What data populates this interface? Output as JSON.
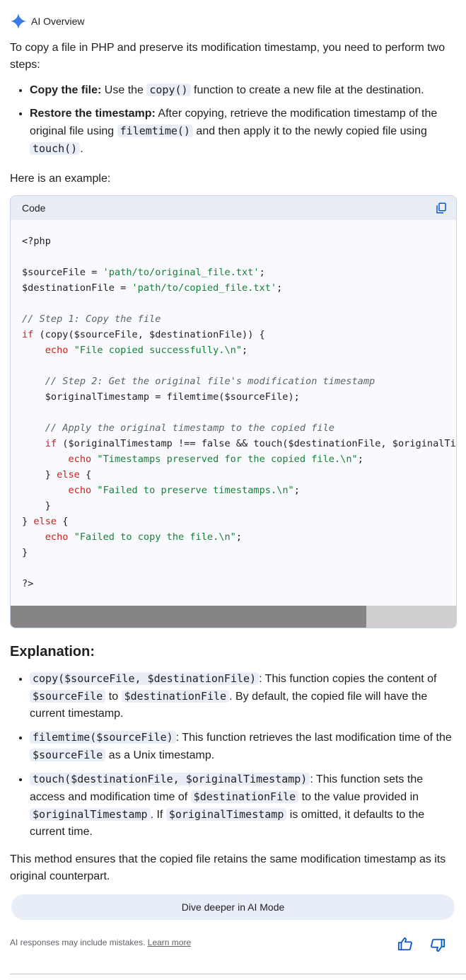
{
  "header": {
    "title": "AI Overview",
    "icon": "sparkle-icon"
  },
  "intro": "To copy a file in PHP and preserve its modification timestamp, you need to perform two steps:",
  "steps": [
    {
      "bold": "Copy the file:",
      "pre": " Use the ",
      "code": "copy()",
      "post": " function to create a new file at the destination."
    },
    {
      "bold": "Restore the timestamp:",
      "pre": " After copying, retrieve the modification timestamp of the original file using ",
      "code": "filemtime()",
      "mid": " and then apply it to the newly copied file using ",
      "code2": "touch()",
      "post": "."
    }
  ],
  "example_label": "Here is an example:",
  "code": {
    "header_label": "Code",
    "copy_icon": "copy-icon"
  },
  "explanation_title": "Explanation:",
  "explanations": [
    {
      "code": "copy($sourceFile, $destinationFile)",
      "t1": ": This function copies the content of ",
      "c2": "$sourceFile",
      "t2": " to ",
      "c3": "$destinationFile",
      "t3": ". By default, the copied file will have the current timestamp."
    },
    {
      "code": "filemtime($sourceFile)",
      "t1": ": This function retrieves the last modification time of the ",
      "c2": "$sourceFile",
      "t2": " as a Unix timestamp."
    },
    {
      "code": "touch($destinationFile, $originalTimestamp)",
      "t1": ": This function sets the access and modification time of ",
      "c2": "$destinationFile",
      "t2": " to the value provided in ",
      "c3": "$originalTimestamp",
      "t3": ". If ",
      "c4": "$originalTimestamp",
      "t4": " is omitted, it defaults to the current time."
    }
  ],
  "conclusion": "This method ensures that the copied file retains the same modification timestamp as its original counterpart.",
  "dive_button": "Dive deeper in AI Mode",
  "footer": {
    "disclaimer": "AI responses may include mistakes.",
    "learn_more": "Learn more"
  },
  "colors": {
    "accent": "#0b57d0",
    "pill": "#e8eef8",
    "code_bg": "#f8fafd"
  }
}
